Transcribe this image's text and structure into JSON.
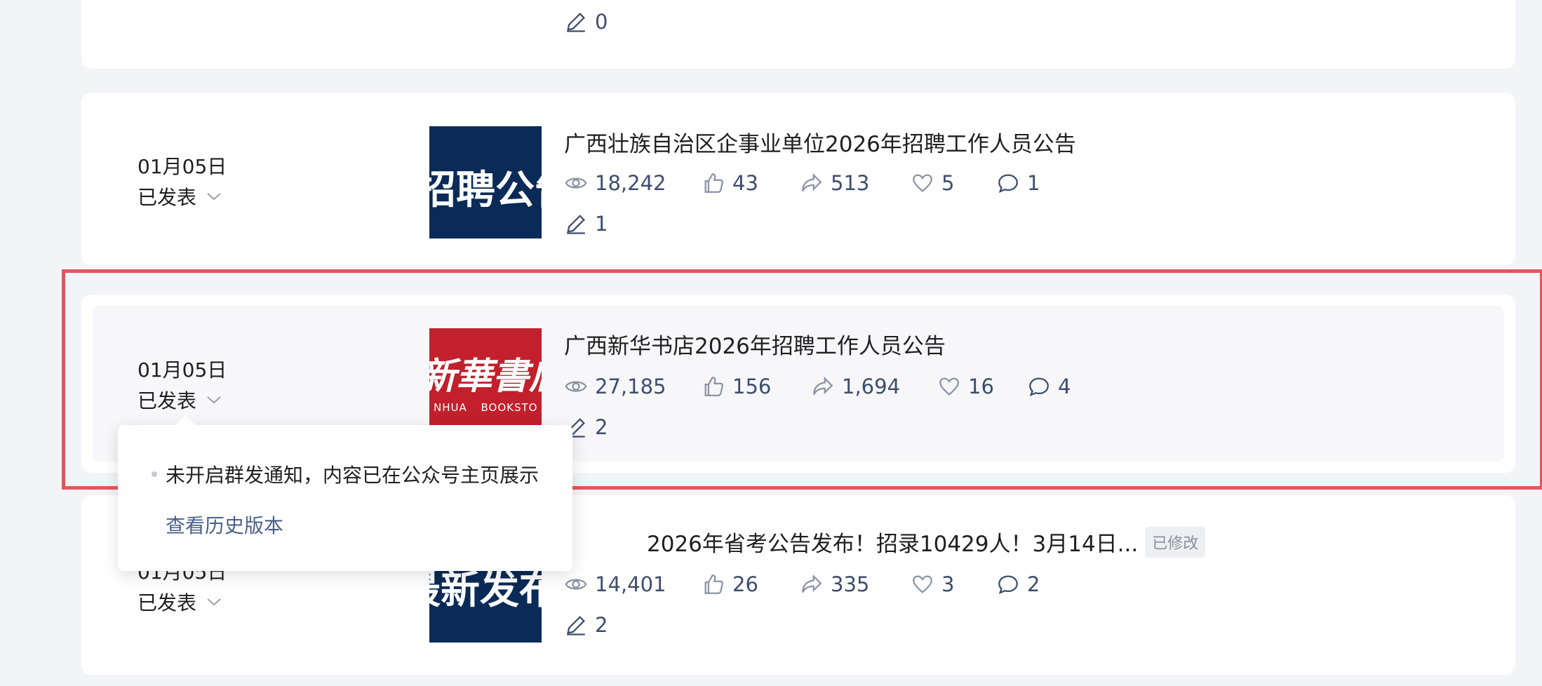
{
  "colors": {
    "accent_text": "#3d4d6d",
    "highlight_border": "#e0585e",
    "thumb_navy": "#0a2b57",
    "thumb_red": "#c1202c"
  },
  "posts": [
    {
      "edits": "0"
    },
    {
      "date": "01月05日",
      "status": "已发表",
      "thumb_text": "招聘公告",
      "title": "广西壮族自治区企事业单位2026年招聘工作人员公告",
      "views": "18,242",
      "likes": "43",
      "shares": "513",
      "favorites": "5",
      "comments": "1",
      "edits": "1"
    },
    {
      "date": "01月05日",
      "status": "已发表",
      "thumb_text": "新華書店",
      "thumb_subtext": "NHUA BOOKSTO",
      "title": "广西新华书店2026年招聘工作人员公告",
      "views": "27,185",
      "likes": "156",
      "shares": "1,694",
      "favorites": "16",
      "comments": "4",
      "edits": "2"
    },
    {
      "date": "01月05日",
      "status": "已发表",
      "thumb_text": "最新发布",
      "title": "2026年省考公告发布！招录10429人！3月14日...",
      "badge": "已修改",
      "views": "14,401",
      "likes": "26",
      "shares": "335",
      "favorites": "3",
      "comments": "2",
      "edits": "2"
    }
  ],
  "popover": {
    "note": "未开启群发通知，内容已在公众号主页展示",
    "history_link": "查看历史版本"
  }
}
